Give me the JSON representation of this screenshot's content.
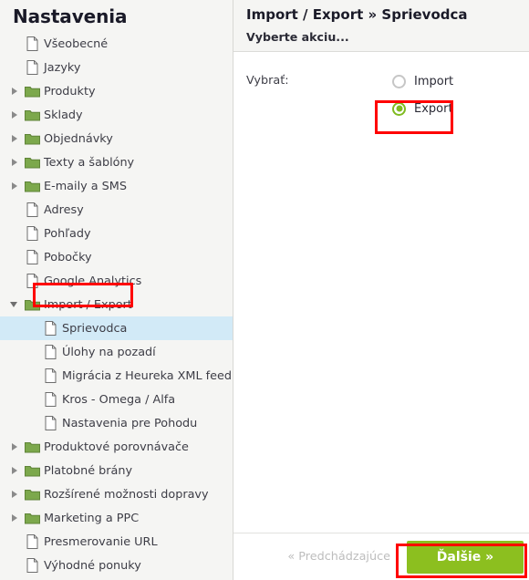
{
  "sidebar": {
    "title": "Nastavenia",
    "items": [
      {
        "label": "Všeobecné",
        "icon": "file-icon",
        "depth": 0,
        "twisty": "none",
        "selected": false
      },
      {
        "label": "Jazyky",
        "icon": "file-icon",
        "depth": 0,
        "twisty": "none",
        "selected": false
      },
      {
        "label": "Produkty",
        "icon": "folder-icon",
        "depth": 0,
        "twisty": "collapsed",
        "selected": false
      },
      {
        "label": "Sklady",
        "icon": "folder-icon",
        "depth": 0,
        "twisty": "collapsed",
        "selected": false
      },
      {
        "label": "Objednávky",
        "icon": "folder-icon",
        "depth": 0,
        "twisty": "collapsed",
        "selected": false
      },
      {
        "label": "Texty a šablóny",
        "icon": "folder-icon",
        "depth": 0,
        "twisty": "collapsed",
        "selected": false
      },
      {
        "label": "E-maily a SMS",
        "icon": "folder-icon",
        "depth": 0,
        "twisty": "collapsed",
        "selected": false
      },
      {
        "label": "Adresy",
        "icon": "file-icon",
        "depth": 0,
        "twisty": "none",
        "selected": false
      },
      {
        "label": "Pohľady",
        "icon": "file-icon",
        "depth": 0,
        "twisty": "none",
        "selected": false
      },
      {
        "label": "Pobočky",
        "icon": "file-icon",
        "depth": 0,
        "twisty": "none",
        "selected": false
      },
      {
        "label": "Google Analytics",
        "icon": "file-icon",
        "depth": 0,
        "twisty": "none",
        "selected": false
      },
      {
        "label": "Import / Export",
        "icon": "folder-icon",
        "depth": 0,
        "twisty": "expanded",
        "selected": false
      },
      {
        "label": "Sprievodca",
        "icon": "file-icon",
        "depth": 1,
        "twisty": "none",
        "selected": true
      },
      {
        "label": "Úlohy na pozadí",
        "icon": "file-icon",
        "depth": 1,
        "twisty": "none",
        "selected": false
      },
      {
        "label": "Migrácia z Heureka XML feedu",
        "icon": "file-icon",
        "depth": 1,
        "twisty": "none",
        "selected": false
      },
      {
        "label": "Kros - Omega / Alfa",
        "icon": "file-icon",
        "depth": 1,
        "twisty": "none",
        "selected": false
      },
      {
        "label": "Nastavenia pre Pohodu",
        "icon": "file-icon",
        "depth": 1,
        "twisty": "none",
        "selected": false
      },
      {
        "label": "Produktové porovnávače",
        "icon": "folder-icon",
        "depth": 0,
        "twisty": "collapsed",
        "selected": false
      },
      {
        "label": "Platobné brány",
        "icon": "folder-icon",
        "depth": 0,
        "twisty": "collapsed",
        "selected": false
      },
      {
        "label": "Rozšírené možnosti dopravy",
        "icon": "folder-icon",
        "depth": 0,
        "twisty": "collapsed",
        "selected": false
      },
      {
        "label": "Marketing a PPC",
        "icon": "folder-icon",
        "depth": 0,
        "twisty": "collapsed",
        "selected": false
      },
      {
        "label": "Presmerovanie URL",
        "icon": "file-icon",
        "depth": 0,
        "twisty": "none",
        "selected": false
      },
      {
        "label": "Výhodné ponuky",
        "icon": "file-icon",
        "depth": 0,
        "twisty": "none",
        "selected": false
      }
    ]
  },
  "panel": {
    "title": "Import / Export » Sprievodca",
    "subtitle": "Vyberte akciu...",
    "form": {
      "label": "Vybrať:",
      "options": [
        {
          "label": "Import",
          "checked": false
        },
        {
          "label": "Export",
          "checked": true
        }
      ]
    },
    "footer": {
      "prev_label": "« Predchádzajúce",
      "next_label": "Ďalšie »"
    }
  },
  "annotations": {
    "colors": {
      "highlight_red": "#ff0000",
      "accent_green": "#8cbf1f",
      "radio_green": "#7fbb20",
      "selection_blue": "#d2eaf7",
      "folder_green": "#7ca84c"
    }
  }
}
